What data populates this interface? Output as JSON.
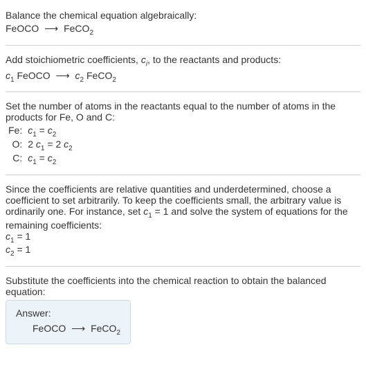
{
  "section1": {
    "intro": "Balance the chemical equation algebraically:",
    "eq_left": "FeOCO",
    "arrow": "⟶",
    "eq_right_compound": "FeCO",
    "eq_right_sub": "2"
  },
  "section2": {
    "intro_part1": "Add stoichiometric coefficients, ",
    "intro_ci_c": "c",
    "intro_ci_i": "i",
    "intro_part2": ", to the reactants and products:",
    "c1_c": "c",
    "c1_sub": "1",
    "left_compound": " FeOCO",
    "arrow": "⟶",
    "c2_c": "c",
    "c2_sub": "2",
    "right_compound": " FeCO",
    "right_sub": "2"
  },
  "section3": {
    "intro": "Set the number of atoms in the reactants equal to the number of atoms in the products for Fe, O and C:",
    "rows": [
      {
        "label": "Fe:",
        "c1": "c",
        "s1": "1",
        "eq": " = ",
        "c2": "c",
        "s2": "2",
        "pre1": "",
        "pre2": ""
      },
      {
        "label": "O:",
        "c1": "c",
        "s1": "1",
        "eq": " = ",
        "c2": "c",
        "s2": "2",
        "pre1": "2 ",
        "pre2": "2 "
      },
      {
        "label": "C:",
        "c1": "c",
        "s1": "1",
        "eq": " = ",
        "c2": "c",
        "s2": "2",
        "pre1": "",
        "pre2": ""
      }
    ]
  },
  "section4": {
    "intro_p1": "Since the coefficients are relative quantities and underdetermined, choose a coefficient to set arbitrarily. To keep the coefficients small, the arbitrary value is ordinarily one. For instance, set ",
    "set_c": "c",
    "set_sub": "1",
    "set_val": " = 1",
    "intro_p2": " and solve the system of equations for the remaining coefficients:",
    "line1_c": "c",
    "line1_sub": "1",
    "line1_val": " = 1",
    "line2_c": "c",
    "line2_sub": "2",
    "line2_val": " = 1"
  },
  "section5": {
    "intro": "Substitute the coefficients into the chemical reaction to obtain the balanced equation:"
  },
  "answer": {
    "label": "Answer:",
    "left": "FeOCO",
    "arrow": "⟶",
    "right_compound": "FeCO",
    "right_sub": "2"
  }
}
